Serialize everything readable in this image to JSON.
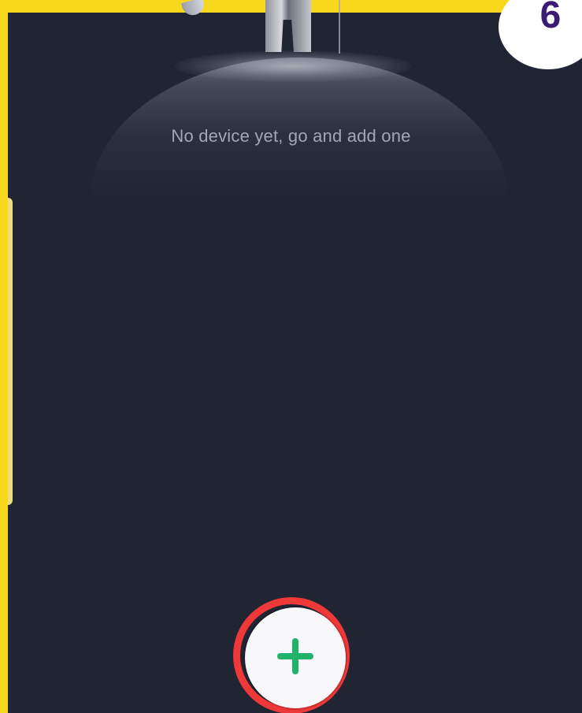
{
  "empty_state": {
    "message": "No device yet, go and add one",
    "illustration_icon": "astronaut-on-planet-icon"
  },
  "step_badge": {
    "number": "6"
  },
  "add_button": {
    "icon": "plus-icon",
    "highlight_color": "#ef3838",
    "icon_color": "#20b36a"
  },
  "colors": {
    "frame": "#f7d81d",
    "screen_background": "#202433",
    "message_text": "#a2a7b6",
    "badge_text": "#3b1a73"
  }
}
